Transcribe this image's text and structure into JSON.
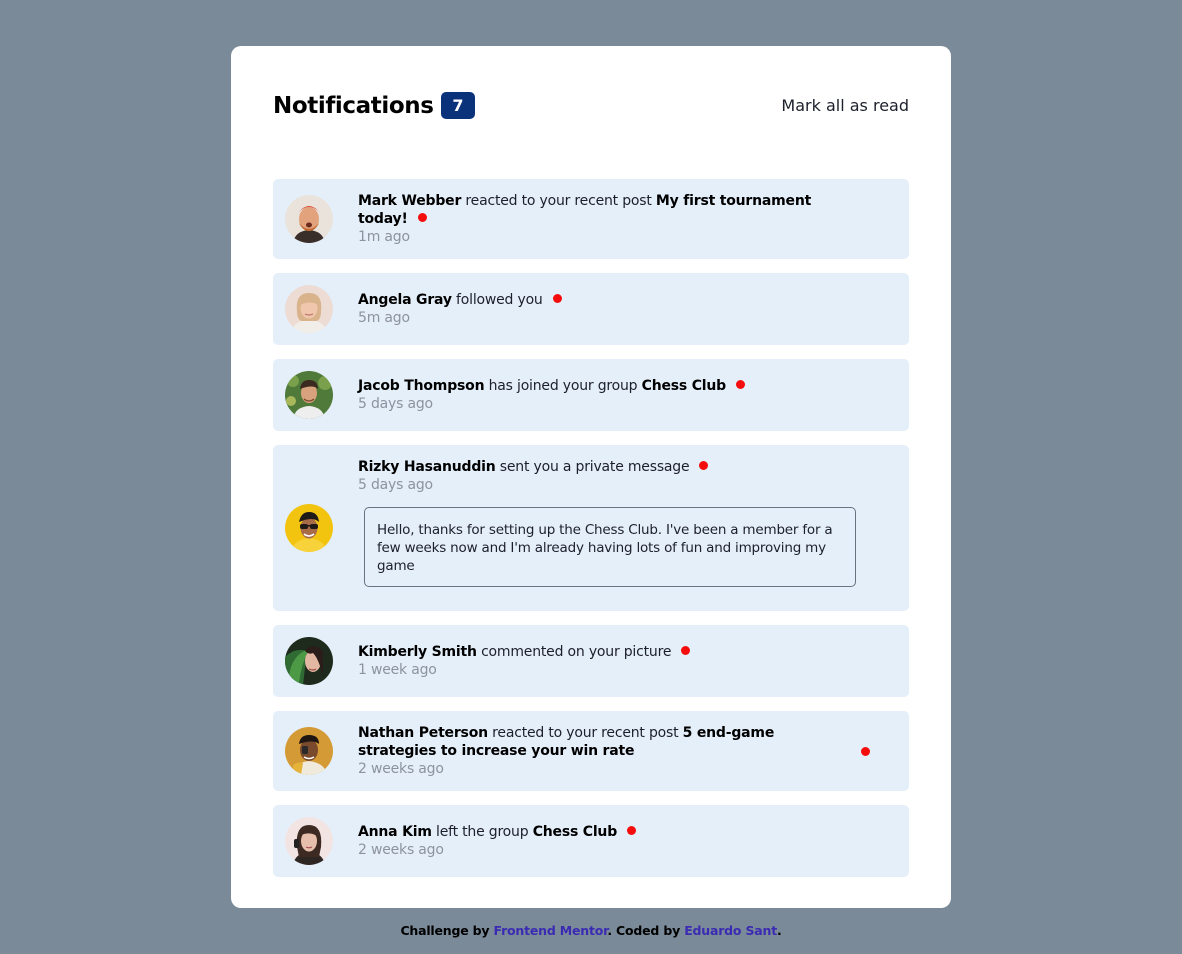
{
  "header": {
    "title": "Notifications",
    "unread_count": "7",
    "mark_all_label": "Mark all as read"
  },
  "colors": {
    "background": "#7a8a99",
    "card": "#ffffff",
    "unread_bg": "#e5effa",
    "badge": "#0a327b",
    "unread_dot": "#f50d0d",
    "link": "#3b2bb3"
  },
  "notifications": [
    {
      "name": "Mark Webber",
      "action": "reacted to your recent post",
      "target": "My first tournament today!",
      "time": "1m ago",
      "avatar": "mark-webber-avatar"
    },
    {
      "name": "Angela Gray",
      "action": "followed you",
      "target": "",
      "time": "5m ago",
      "avatar": "angela-gray-avatar"
    },
    {
      "name": "Jacob Thompson",
      "action": "has joined your group",
      "target": "Chess Club",
      "time": "5 days ago",
      "avatar": "jacob-thompson-avatar"
    },
    {
      "name": "Rizky Hasanuddin",
      "action": "sent you a private message",
      "target": "",
      "time": "5 days ago",
      "message": "Hello, thanks for setting up the Chess Club. I've been a member for a few weeks now and I'm already having lots of fun and improving my game",
      "avatar": "rizky-hasanuddin-avatar"
    },
    {
      "name": "Kimberly Smith",
      "action": "commented on your picture",
      "target": "",
      "time": "1 week ago",
      "avatar": "kimberly-smith-avatar"
    },
    {
      "name": "Nathan Peterson",
      "action": "reacted to your recent post",
      "target": "5 end-game strategies to increase your win rate",
      "time": "2 weeks ago",
      "avatar": "nathan-peterson-avatar"
    },
    {
      "name": "Anna Kim",
      "action": "left the group",
      "target": "Chess Club",
      "time": "2 weeks ago",
      "avatar": "anna-kim-avatar"
    }
  ],
  "footer": {
    "prefix": "Challenge by",
    "link1": "Frontend Mentor",
    "middle": ". Coded by",
    "link2": "Eduardo Sant",
    "suffix": "."
  }
}
